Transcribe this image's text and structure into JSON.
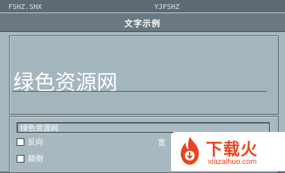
{
  "topbar": {
    "left_text": "FSHZ.SHX",
    "mid_text": "YJFSHZ"
  },
  "dialog": {
    "title": "文字示例",
    "preview_text": "绿色资源网",
    "text_value": "绿色资源网",
    "options": [
      {
        "label": "反向",
        "checked": false
      },
      {
        "label": "颠倒",
        "checked": false
      }
    ],
    "width_label": "宽"
  },
  "watermark": {
    "title": "下载火",
    "subtitle": "xiazaihuo.com"
  },
  "colors": {
    "panel": "#a7b8c0",
    "titlebar": "#6a7981",
    "baseline": "#c0262a",
    "brand": "#e8451e"
  }
}
